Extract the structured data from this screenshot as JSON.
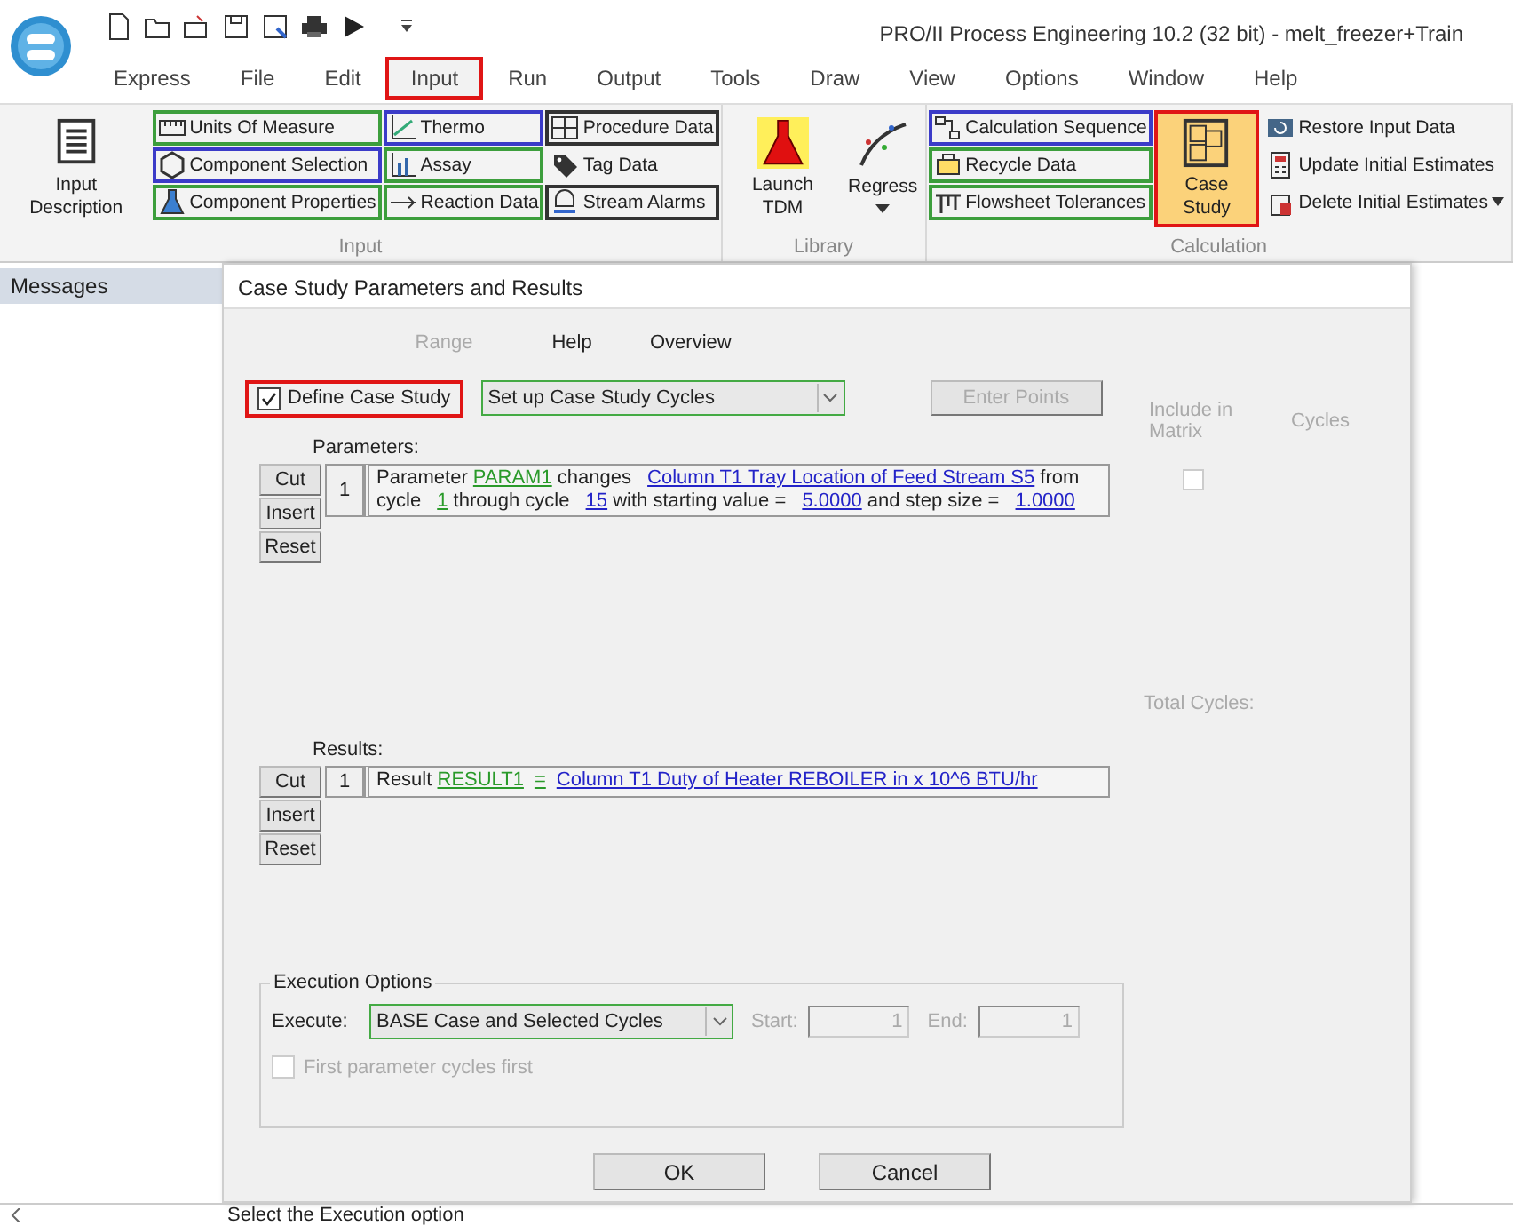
{
  "window": {
    "title": "PRO/II Process Engineering 10.2 (32 bit) - melt_freezer+Train"
  },
  "menu_tabs": [
    {
      "label": "Express",
      "selected": false,
      "highlighted": false
    },
    {
      "label": "File",
      "selected": false,
      "highlighted": false
    },
    {
      "label": "Edit",
      "selected": false,
      "highlighted": false
    },
    {
      "label": "Input",
      "selected": true,
      "highlighted": true
    },
    {
      "label": "Run",
      "selected": false,
      "highlighted": false
    },
    {
      "label": "Output",
      "selected": false,
      "highlighted": false
    },
    {
      "label": "Tools",
      "selected": false,
      "highlighted": false
    },
    {
      "label": "Draw",
      "selected": false,
      "highlighted": false
    },
    {
      "label": "View",
      "selected": false,
      "highlighted": false
    },
    {
      "label": "Options",
      "selected": false,
      "highlighted": false
    },
    {
      "label": "Window",
      "selected": false,
      "highlighted": false
    },
    {
      "label": "Help",
      "selected": false,
      "highlighted": false
    }
  ],
  "ribbon": {
    "groups": [
      {
        "label": "Input",
        "columns": [
          [
            {
              "kind": "large",
              "label": "Input Description",
              "selected": false
            }
          ],
          [
            {
              "kind": "small",
              "label": "Units Of Measure",
              "color": "#3c9e3c"
            },
            {
              "kind": "small",
              "label": "Component Selection",
              "color": "#3b3bc8"
            },
            {
              "kind": "small",
              "label": "Component Properties",
              "color": "#3c9e3c"
            }
          ],
          [
            {
              "kind": "small",
              "label": "Thermo",
              "color": "#3b3bc8"
            },
            {
              "kind": "small",
              "label": "Assay",
              "color": "#3c9e3c"
            },
            {
              "kind": "small",
              "label": "Reaction Data",
              "color": "#3c9e3c"
            }
          ],
          [
            {
              "kind": "small",
              "label": "Procedure Data",
              "color": "#333333"
            },
            {
              "kind": "small",
              "label": "Tag Data"
            },
            {
              "kind": "small",
              "label": "Stream Alarms",
              "color": "#333333"
            }
          ]
        ]
      },
      {
        "label": "Library",
        "columns": [
          [
            {
              "kind": "large",
              "label": "Launch TDM",
              "selected": false
            }
          ],
          [
            {
              "kind": "large",
              "label": "Regress",
              "selected": false
            }
          ]
        ]
      },
      {
        "label": "Calculation",
        "columns": [
          [
            {
              "kind": "small",
              "label": "Calculation Sequence",
              "color": "#3b3bc8"
            },
            {
              "kind": "small",
              "label": "Recycle Data",
              "color": "#3c9e3c"
            },
            {
              "kind": "small",
              "label": "Flowsheet Tolerances",
              "color": "#3c9e3c"
            }
          ],
          [
            {
              "kind": "large",
              "label": "Case Study",
              "selected": true,
              "color": "#e01515"
            }
          ],
          [
            {
              "kind": "small",
              "label": "Restore Input Data"
            },
            {
              "kind": "small",
              "label": "Update Initial Estimates"
            },
            {
              "kind": "small",
              "label": "Delete Initial Estimates"
            }
          ]
        ]
      }
    ]
  },
  "sidebar": {
    "title": "Messages"
  },
  "dialog": {
    "title": "Case Study Parameters and Results",
    "menu": [
      {
        "label": "Range",
        "disabled": true
      },
      {
        "label": "Help",
        "disabled": false
      },
      {
        "label": "Overview",
        "disabled": false
      }
    ],
    "define_case_study": {
      "label": "Define Case Study",
      "checked": true,
      "highlighted": true
    },
    "mode_select": {
      "value": "Set up Case Study Cycles"
    },
    "enter_points": {
      "label": "Enter Points",
      "disabled": true
    },
    "include_header": "Include in Matrix",
    "cycles_header": "Cycles",
    "total_cycles_label": "Total Cycles:",
    "parameters": {
      "label": "Parameters:",
      "buttons": [
        "Cut",
        "Insert",
        "Reset"
      ],
      "rows": [
        {
          "number": "1",
          "include": false,
          "segments": [
            {
              "kind": "plain",
              "text": "Parameter "
            },
            {
              "kind": "name",
              "text": "PARAM1"
            },
            {
              "kind": "plain",
              "text": " changes "
            },
            {
              "kind": "value",
              "text": "Column T1 Tray Location of Feed Stream S5"
            },
            {
              "kind": "plain",
              "text": "  from cycle "
            },
            {
              "kind": "name",
              "text": "1"
            },
            {
              "kind": "plain",
              "text": " through cycle "
            },
            {
              "kind": "value",
              "text": "15"
            },
            {
              "kind": "plain",
              "text": " with starting value = "
            },
            {
              "kind": "value",
              "text": "5.0000"
            },
            {
              "kind": "plain",
              "text": " and step size = "
            },
            {
              "kind": "value",
              "text": "1.0000"
            }
          ]
        }
      ]
    },
    "results": {
      "label": "Results:",
      "buttons": [
        "Cut",
        "Insert",
        "Reset"
      ],
      "rows": [
        {
          "number": "1",
          "segments": [
            {
              "kind": "plain",
              "text": "Result "
            },
            {
              "kind": "name",
              "text": "RESULT1"
            },
            {
              "kind": "name",
              "text": "="
            },
            {
              "kind": "value",
              "text": "Column T1 Duty of Heater REBOILER in x 10^6 BTU/hr"
            }
          ]
        }
      ]
    },
    "execution": {
      "legend": "Execution Options",
      "execute_label": "Execute:",
      "execute_value": "BASE Case and Selected Cycles",
      "start_label": "Start:",
      "start_value": "1",
      "end_label": "End:",
      "end_value": "1",
      "range_disabled": true,
      "first_param": {
        "label": "First parameter cycles first",
        "checked": false,
        "disabled": true
      }
    },
    "buttons": [
      "OK",
      "Cancel"
    ]
  },
  "status_bar": {
    "text": "Select the Execution option"
  }
}
